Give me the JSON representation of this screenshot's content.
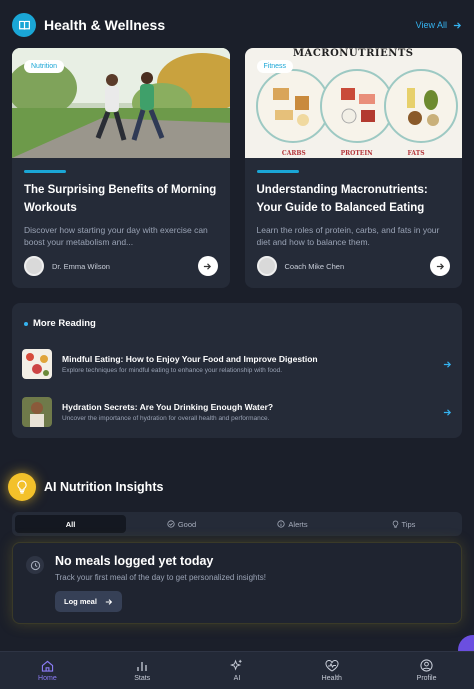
{
  "header": {
    "title": "Health & Wellness",
    "view_all": "View All",
    "icon": "book-icon"
  },
  "cards": [
    {
      "tag": "Nutrition",
      "title": "The Surprising Benefits of Morning Workouts",
      "desc": "Discover how starting your day with exercise can boost your metabolism and...",
      "author": "Dr. Emma Wilson"
    },
    {
      "tag": "Fitness",
      "title": "Understanding Macronutrients: Your Guide to Balanced Eating",
      "desc": "Learn the roles of protein, carbs, and fats in your diet and how to balance them.",
      "author": "Coach Mike Chen",
      "image_text": {
        "heading": "MACRONUTRIENTS",
        "labels": [
          "CARBS",
          "PROTEIN",
          "FATS"
        ]
      }
    }
  ],
  "more_reading": {
    "title": "More Reading",
    "items": [
      {
        "title": "Mindful Eating: How to Enjoy Your Food and Improve Digestion",
        "sub": "Explore techniques for mindful eating to enhance your relationship with food."
      },
      {
        "title": "Hydration Secrets: Are You Drinking Enough Water?",
        "sub": "Uncover the importance of hydration for overall health and performance."
      }
    ]
  },
  "ai": {
    "title": "AI Nutrition Insights",
    "tabs": [
      {
        "label": "All"
      },
      {
        "label": "Good"
      },
      {
        "label": "Alerts"
      },
      {
        "label": "Tips"
      }
    ],
    "empty_title": "No meals logged yet today",
    "empty_sub": "Track your first meal of the day to get personalized insights!",
    "button": "Log meal"
  },
  "nav": [
    {
      "label": "Home"
    },
    {
      "label": "Stats"
    },
    {
      "label": "AI"
    },
    {
      "label": "Health"
    },
    {
      "label": "Profile"
    }
  ],
  "colors": {
    "accent": "#1aa6d6",
    "active_nav": "#8b7cf6",
    "bulb": "#f3c12a"
  }
}
